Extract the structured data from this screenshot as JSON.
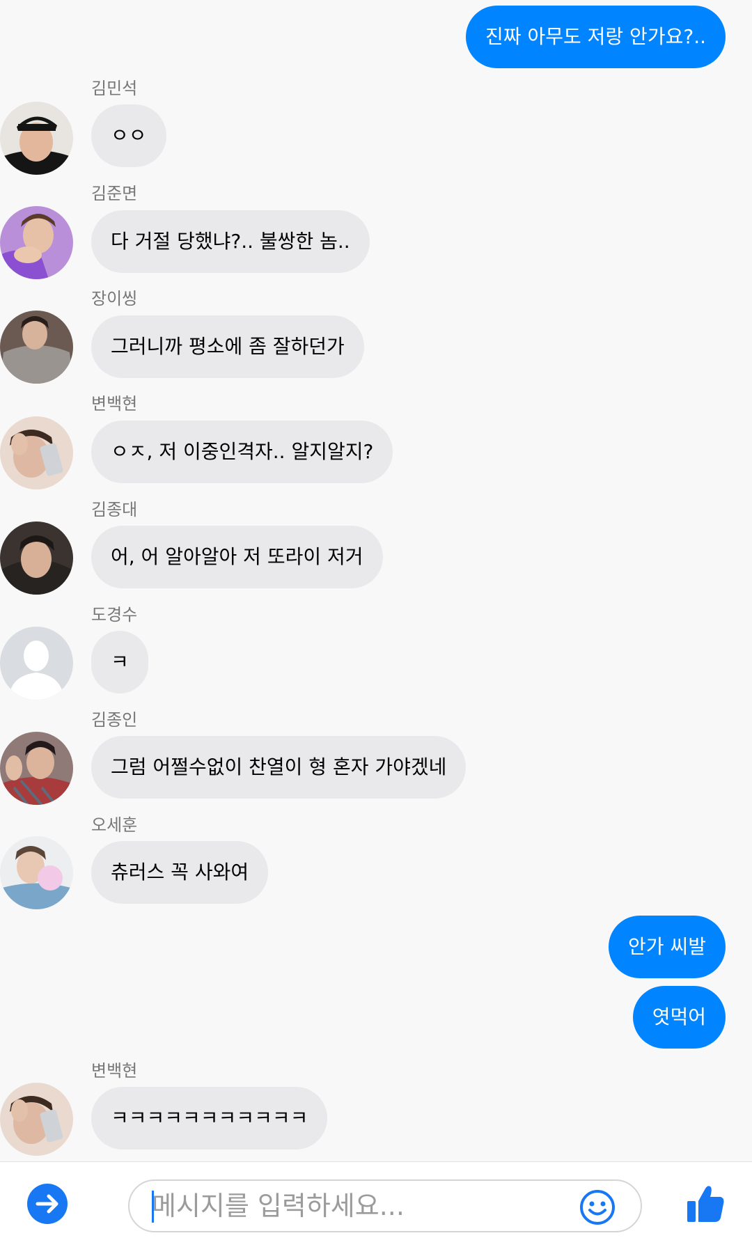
{
  "conversation": {
    "messages": [
      {
        "sender": "",
        "text": "진짜 아무도 저랑 안가요?..",
        "direction": "out"
      },
      {
        "sender": "김민석",
        "text": "ㅇㅇ",
        "direction": "in"
      },
      {
        "sender": "김준면",
        "text": "다 거절 당했냐?.. 불쌍한 놈..",
        "direction": "in"
      },
      {
        "sender": "장이씽",
        "text": "그러니까 평소에 좀 잘하던가",
        "direction": "in"
      },
      {
        "sender": "변백현",
        "text": "ㅇㅈ, 저 이중인격자.. 알지알지?",
        "direction": "in"
      },
      {
        "sender": "김종대",
        "text": "어, 어 알아알아 저 또라이 저거",
        "direction": "in"
      },
      {
        "sender": "도경수",
        "text": "ㅋ",
        "direction": "in"
      },
      {
        "sender": "김종인",
        "text": "그럼 어쩔수없이 찬열이 형 혼자 가야겠네",
        "direction": "in"
      },
      {
        "sender": "오세훈",
        "text": "츄러스 꼭 사와여",
        "direction": "in"
      },
      {
        "sender": "",
        "text": "안가 씨발",
        "direction": "out"
      },
      {
        "sender": "",
        "text": "엿먹어",
        "direction": "out"
      },
      {
        "sender": "변백현",
        "text": "ㅋㅋㅋㅋㅋㅋㅋㅋㅋㅋㅋ",
        "direction": "in"
      }
    ]
  },
  "composer": {
    "placeholder": "메시지를 입력하세요...",
    "left_icon": "arrow-right-circle-icon",
    "emoji_icon": "smiley-icon",
    "like_icon": "thumbs-up-icon"
  },
  "colors": {
    "outgoing_bubble": "#0084ff",
    "incoming_bubble": "#e9e9eb",
    "accent": "#1877f2"
  }
}
